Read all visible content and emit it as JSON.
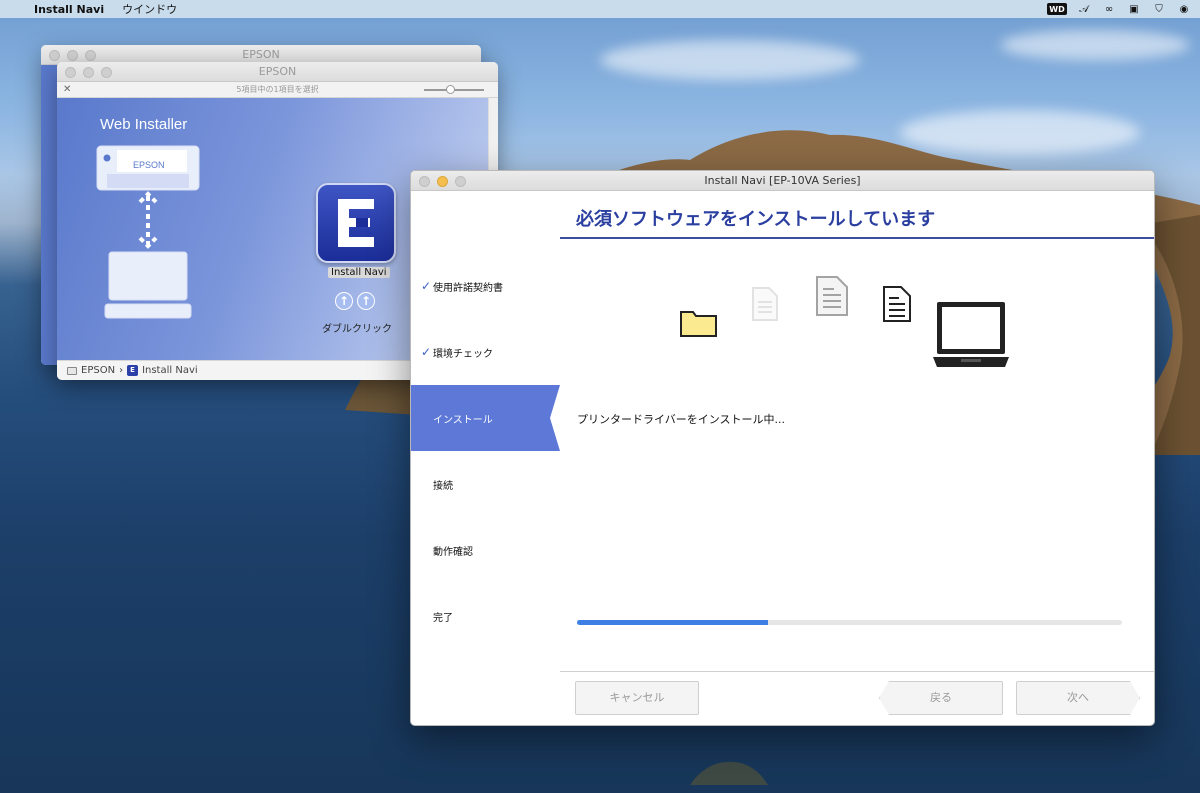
{
  "menubar": {
    "app_name": "Install Navi",
    "menu_window": "ウインドウ",
    "status_icons": [
      "wd-icon",
      "a-icon",
      "creative-cloud-icon",
      "clapper-icon",
      "shield-icon",
      "1password-icon"
    ],
    "wd_label": "WD"
  },
  "finder_back": {
    "title": "EPSON"
  },
  "finder_front": {
    "title": "EPSON",
    "toolbar_status": "5項目中の1項目を選択",
    "web_installer_label": "Web Installer",
    "printer_brand": "EPSON",
    "app_icon_label": "Install Navi",
    "double_click_label": "ダブルクリック",
    "path": [
      "EPSON",
      "Install Navi"
    ],
    "path_separator": "›"
  },
  "installer": {
    "window_title": "Install Navi [EP-10VA Series]",
    "heading": "必須ソフトウェアをインストールしています",
    "steps": [
      {
        "label": "使用許諾契約書",
        "done": true
      },
      {
        "label": "環境チェック",
        "done": true
      },
      {
        "label": "インストール",
        "active": true
      },
      {
        "label": "接続"
      },
      {
        "label": "動作確認"
      },
      {
        "label": "完了"
      }
    ],
    "status_message": "プリンタードライバーをインストール中...",
    "progress_fraction": 0.35,
    "cancel_label": "キャンセル",
    "back_label": "戻る",
    "next_label": "次へ",
    "check_mark": "✓"
  },
  "colors": {
    "accent": "#5d78d6",
    "title_blue": "#2a3fa0",
    "progress": "#3e7fe6"
  }
}
